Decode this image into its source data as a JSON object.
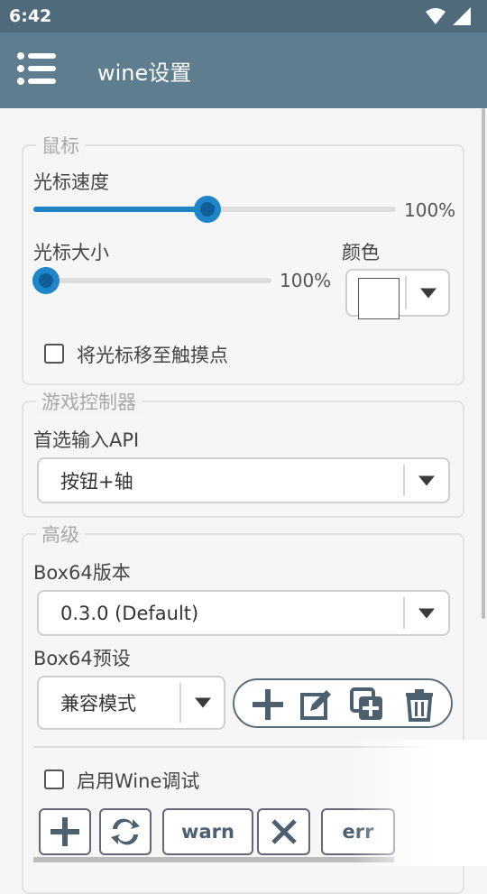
{
  "status": {
    "time": "6:42"
  },
  "toolbar": {
    "title": "wine设置"
  },
  "mouse": {
    "legend": "鼠标",
    "speed_label": "光标速度",
    "speed_value": "100%",
    "speed_fraction": 0.48,
    "size_label": "光标大小",
    "size_value": "100%",
    "size_fraction": 0.0,
    "color_label": "颜色",
    "color_value": "#ffffff",
    "move_to_touch_label": "将光标移至触摸点",
    "move_to_touch_checked": false
  },
  "gamepad": {
    "legend": "游戏控制器",
    "api_label": "首选输入API",
    "api_value": "按钮+轴"
  },
  "advanced": {
    "legend": "高级",
    "box64_version_label": "Box64版本",
    "box64_version_value": "0.3.0 (Default)",
    "box64_preset_label": "Box64预设",
    "box64_preset_value": "兼容模式",
    "preset_actions": [
      "add-icon",
      "edit-icon",
      "duplicate-icon",
      "delete-icon"
    ],
    "wine_debug_label": "启用Wine调试",
    "wine_debug_checked": false,
    "debug_buttons": {
      "warn": "warn",
      "err": "err"
    }
  },
  "colors": {
    "toolbar": "#5e7d8f",
    "statusbar": "#4f6b7b",
    "accent": "#1f83c4"
  }
}
